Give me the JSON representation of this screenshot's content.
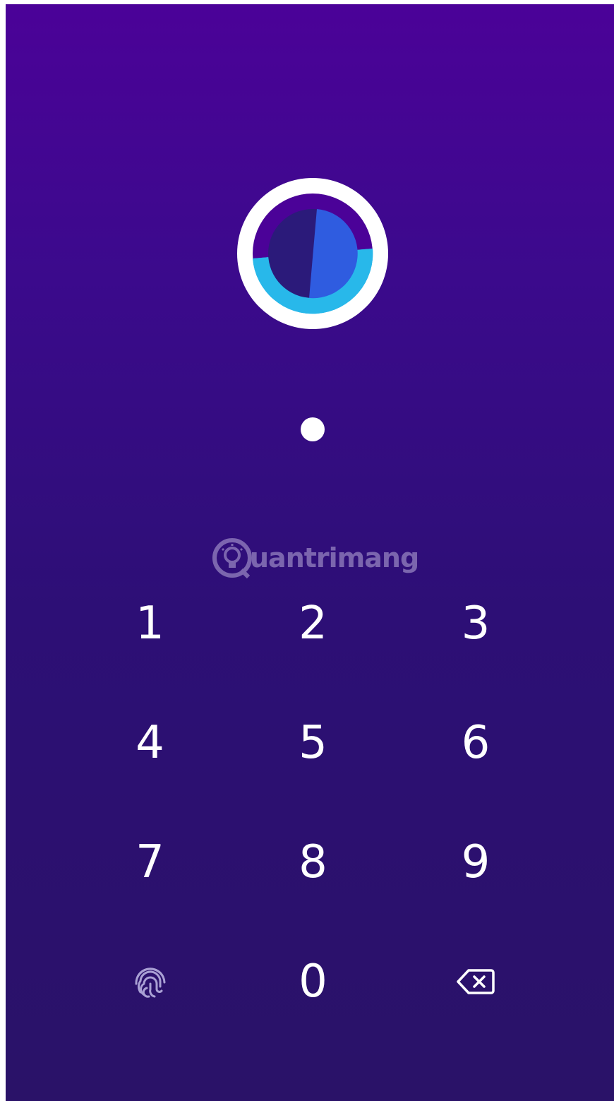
{
  "app": {
    "background_top": "#4b0298",
    "background_bottom": "#2a1268",
    "logo_icon": "app-logo-icon",
    "logo_colors": {
      "ring": "#ffffff",
      "dark_half": "#2b1a7a",
      "blue_half": "#2f5ce0",
      "cyan_arc": "#28b8ea",
      "purple_arc": "#4b0298"
    }
  },
  "pin": {
    "entered_count": 1
  },
  "watermark": {
    "text": "uantrimang",
    "icon": "lightbulb-icon"
  },
  "keypad": {
    "keys": [
      {
        "label": "1"
      },
      {
        "label": "2"
      },
      {
        "label": "3"
      },
      {
        "label": "4"
      },
      {
        "label": "5"
      },
      {
        "label": "6"
      },
      {
        "label": "7"
      },
      {
        "label": "8"
      },
      {
        "label": "9"
      }
    ],
    "zero": "0",
    "fingerprint_icon": "fingerprint-icon",
    "backspace_icon": "backspace-icon"
  }
}
